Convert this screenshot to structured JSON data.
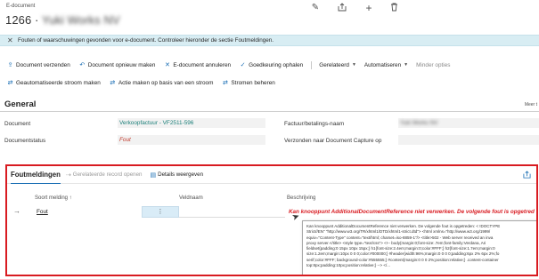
{
  "header": {
    "breadcrumb": "E-document",
    "title_prefix": "1266 · ",
    "title_blurred": "Yuki Works NV",
    "icons": [
      "pencil-icon",
      "share-icon",
      "plus-icon",
      "trash-icon"
    ]
  },
  "banner": {
    "message": "Fouten of waarschuwingen gevonden voor e-document. Controleer hieronder de sectie Foutmeldingen."
  },
  "actions_row1": {
    "send": "Document verzenden",
    "resend": "Document opnieuw maken",
    "cancel": "E-document annuleren",
    "approval": "Goedkeuring ophalen",
    "related": "Gerelateerd",
    "automate": "Automatiseren",
    "fewer": "Minder opties"
  },
  "actions_row2": {
    "auto_flow": "Geautomatiseerde stroom maken",
    "flow_action": "Actie maken op basis van een stroom",
    "manage_flows": "Stromen beheren"
  },
  "general": {
    "title": "General",
    "more": "Meer t",
    "fields": {
      "document_label": "Document",
      "document_value": "Verkoopfactuur - VF2511-596",
      "status_label": "Documentstatus",
      "status_value": "Fout",
      "bill_label": "Factuur/betalings-naam",
      "bill_value": "Yuki Works NV",
      "forward_label": "Verzonden naar Document Capture op",
      "forward_value": ""
    }
  },
  "errors": {
    "title": "Foutmeldingen",
    "open_record": "Gerelateerde record openen",
    "details": "Details weergeven",
    "columns": {
      "type": "Soort melding ↑",
      "field": "Veldnaam",
      "description": "Beschrijving"
    },
    "row": {
      "type": "Fout",
      "menu": "⋮",
      "field": "",
      "description": "Kan knooppunt AdditionalDocumentReference niet verwerken. De volgende fout is opgetred"
    },
    "tooltip_lines": [
      "Kan knooppunt AdditionalDocumentReference niet verwerken. De volgende fout is opgetreden: < !DOCTYPE",
      "Strict//EN\" \"http://www.w3.org/TR/xhtml1/DTD/xhtml1-strict.dtd\"> <html xmlns=\"http://www.w3.org/1999/",
      "equiv=\"Content-Type\" content=\"text/html; charset=iso-8859-1\"/> <title>502 - Web server received an inva",
      "proxy server.</title> <style type=\"text/css\"> <!-- body{margin:0;font-size:.7em;font-family:Verdana, Ari",
      "fieldset{padding:0 15px 10px 15px;} h1{font-size:2.4em;margin:0;color:#FFF;} h2{font-size:1.7em;margin:0",
      "size:1.2em;margin:10px 0 0 0;color:#000000;} #header{width:96%;margin:0 0 0 0;padding:6px 2% 6px 2%;fo",
      "serif;color:#FFF; background-color:#555555;} #content{margin:0 0 0 2%;position:relative;} .content-container",
      "top:8px;padding:10px;position:relative;} --> </..."
    ]
  }
}
